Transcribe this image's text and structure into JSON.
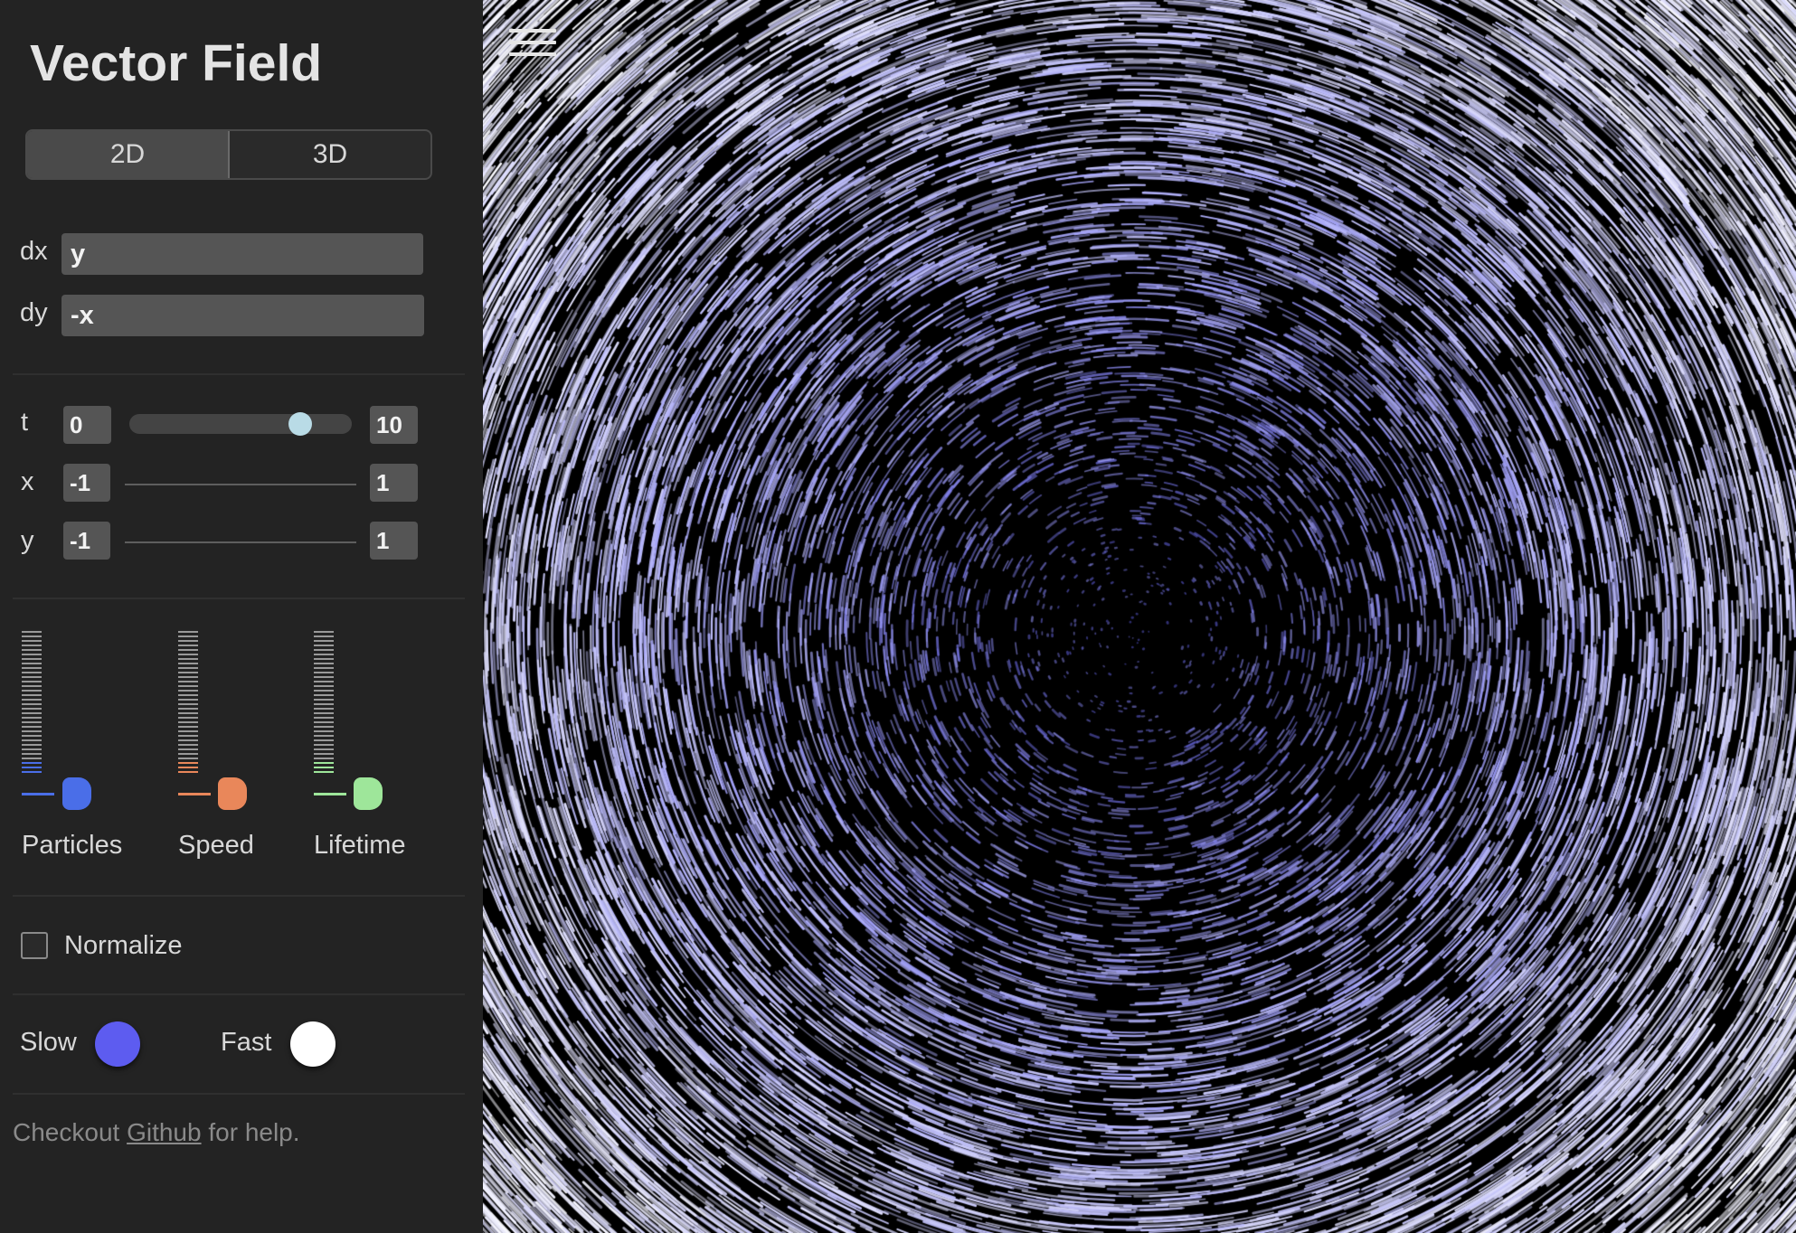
{
  "app": {
    "title": "Vector Field"
  },
  "mode_toggle": {
    "options": [
      "2D",
      "3D"
    ],
    "selected": "2D"
  },
  "expressions": {
    "dx_label": "dx",
    "dx_value": "y",
    "dy_label": "dy",
    "dy_value": "-x"
  },
  "ranges": {
    "t": {
      "label": "t",
      "min": "0",
      "max": "10",
      "value_fraction": 0.77
    },
    "x": {
      "label": "x",
      "min": "-1",
      "max": "1"
    },
    "y": {
      "label": "y",
      "min": "-1",
      "max": "1"
    }
  },
  "sliders": [
    {
      "label": "Particles",
      "color": "#4a6ee8",
      "level": 0.1
    },
    {
      "label": "Speed",
      "color": "#e9875a",
      "level": 0.1
    },
    {
      "label": "Lifetime",
      "color": "#9ee69a",
      "level": 0.1
    }
  ],
  "normalize": {
    "label": "Normalize",
    "checked": false
  },
  "colors": {
    "slow_label": "Slow",
    "slow_color": "#5d5cf0",
    "fast_label": "Fast",
    "fast_color": "#ffffff"
  },
  "footer": {
    "prefix": "Checkout ",
    "link": "Github",
    "suffix": " for help."
  },
  "icons": {
    "menu": "hamburger-menu-icon"
  }
}
